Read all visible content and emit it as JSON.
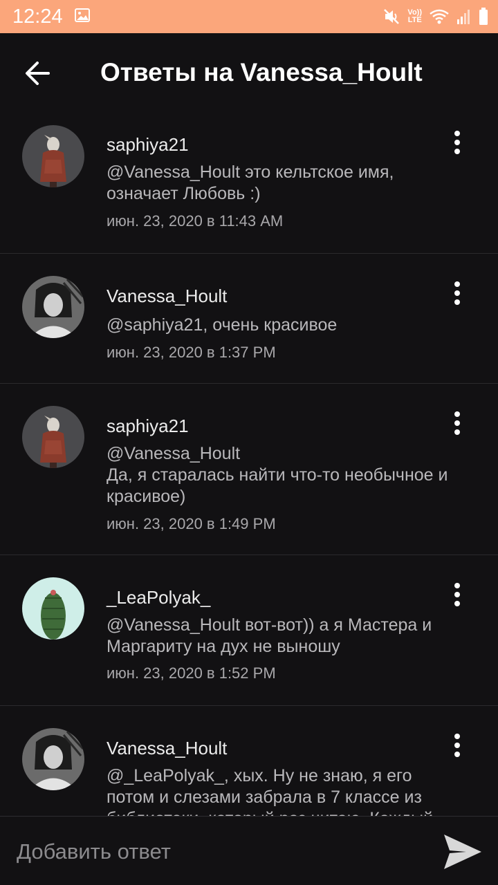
{
  "status_bar": {
    "time": "12:24",
    "icons": [
      "image-icon",
      "mute-icon",
      "volte-icon",
      "wifi-icon",
      "signal-icon",
      "battery-icon"
    ],
    "volte_label_1": "Vo))",
    "volte_label_2": "LTE",
    "background": "#fba67b"
  },
  "header": {
    "title": "Ответы на Vanessa_Hoult",
    "back_icon": "arrow-left-icon"
  },
  "replies": [
    {
      "username": "saphiya21",
      "text": "@Vanessa_Hoult  это кельтское имя,\nозначает Любовь :)",
      "date": "июн. 23, 2020 в 11:43 AM",
      "avatar": "avatar-saphiya21"
    },
    {
      "username": "Vanessa_Hoult",
      "text": "@saphiya21, очень красивое",
      "date": "июн. 23, 2020 в 1:37 PM",
      "avatar": "avatar-vanessa"
    },
    {
      "username": "saphiya21",
      "text": "@Vanessa_Hoult\nДа, я старалась найти что-то необычное и\nкрасивое)",
      "date": "июн. 23, 2020 в 1:49 PM",
      "avatar": "avatar-saphiya21"
    },
    {
      "username": "_LeaPolyak_",
      "text": "@Vanessa_Hoult  вот-вот)) а я Мастера и\nМаргариту на дух не выношу",
      "date": "июн. 23, 2020 в 1:52 PM",
      "avatar": "avatar-cactus"
    },
    {
      "username": "Vanessa_Hoult",
      "text": "@_LeaPolyak_, хых. Ну не знаю, я его\nпотом и слезами забрала в 7 классе из\nбиблиотеки, который раз читаю. Каждый",
      "date": "",
      "avatar": "avatar-vanessa"
    }
  ],
  "footer": {
    "placeholder": "Добавить ответ",
    "send_icon": "send-icon"
  },
  "colors": {
    "background": "#121113",
    "divider": "#2b2a2d",
    "text_primary": "#ececec",
    "text_secondary": "#b9b8bb"
  }
}
